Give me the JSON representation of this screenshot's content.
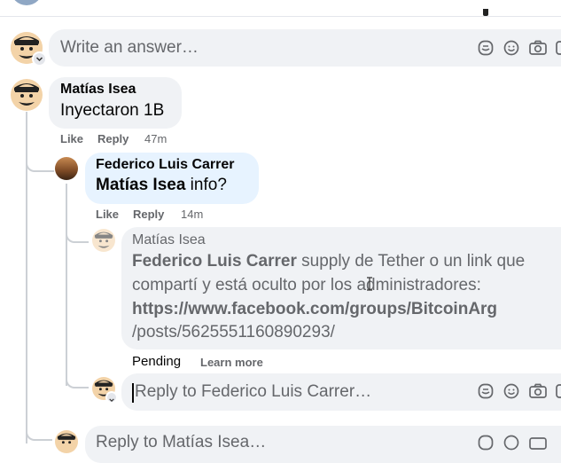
{
  "top_answer": {
    "placeholder": "Write an answer…"
  },
  "comment1": {
    "author": "Matías Isea",
    "text": "Inyectaron 1B",
    "like": "Like",
    "reply": "Reply",
    "time": "47m"
  },
  "reply1": {
    "author": "Federico Luis Carrer",
    "mention": "Matías Isea",
    "text": " info?",
    "like": "Like",
    "reply": "Reply",
    "time": "14m"
  },
  "pending_reply": {
    "author": "Matías Isea",
    "mention": "Federico Luis Carrer",
    "text_line1": " supply de Tether o un link que",
    "text_line2": "compartí y está oculto por los administradores:",
    "link_line1": "https://www.facebook.com/groups/BitcoinArg",
    "link_line2": "/posts/5625551160890293/",
    "status": "Pending",
    "learn_more": "Learn more"
  },
  "reply_input": {
    "placeholder": "Reply to Federico Luis Carrer…"
  },
  "bottom_input": {
    "placeholder": "Reply to Matías Isea…"
  },
  "icons": [
    "sticker-icon",
    "emoji-icon",
    "camera-icon"
  ],
  "colors": {
    "bubble": "#f0f2f5",
    "highlight_bubble": "#e7f3ff",
    "muted": "#65676b",
    "pending_text": "#65676b"
  }
}
